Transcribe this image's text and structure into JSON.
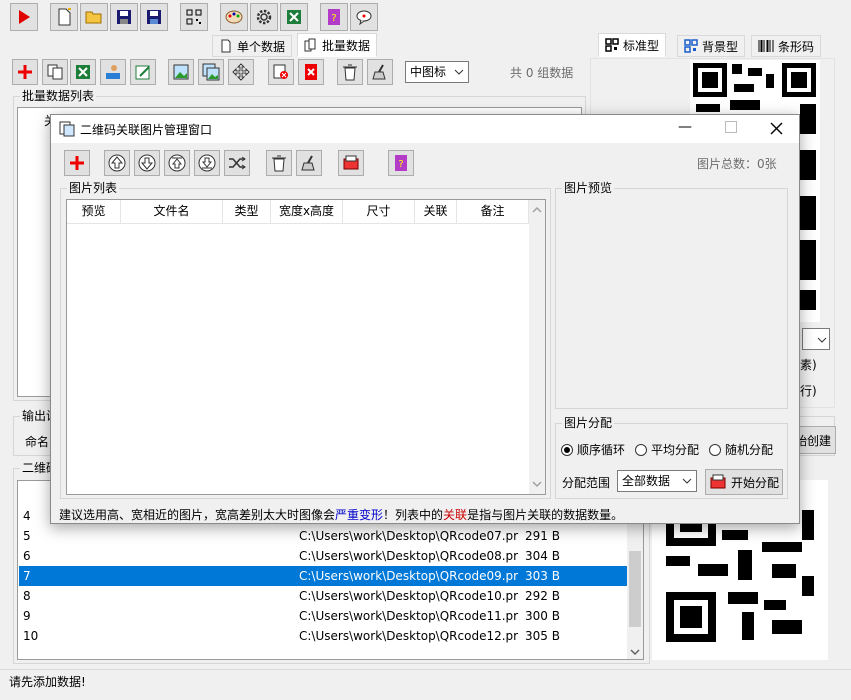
{
  "main_toolbar": {
    "icons": [
      "play-icon",
      "new-file-icon",
      "open-folder-icon",
      "save-icon",
      "save-as-icon",
      "barcode-scan-icon",
      "palette-icon",
      "gear-icon",
      "excel-icon",
      "help-book-icon",
      "chat-icon"
    ]
  },
  "data_tabs": [
    {
      "label": "单个数据",
      "selected": false
    },
    {
      "label": "批量数据",
      "selected": true
    }
  ],
  "preview_tabs": [
    {
      "label": "标准型",
      "selected": true
    },
    {
      "label": "背景型",
      "selected": false
    },
    {
      "label": "条形码",
      "selected": false
    }
  ],
  "batch": {
    "view_mode": "中图标",
    "group_count": "共 0 组数据",
    "list_title": "批量数据列表",
    "partial_col": "关"
  },
  "output": {
    "title_partial": "输出设",
    "name_partial": "命名",
    "create_partial": "始创建"
  },
  "right_partial": {
    "text1": "素)",
    "text2": "行)"
  },
  "qr_list": {
    "title_partial": "二维码",
    "rows": [
      {
        "num": "4",
        "path": "",
        "size": ""
      },
      {
        "num": "5",
        "path": "C:\\Users\\work\\Desktop\\QRcode07.pr",
        "size": "291 B"
      },
      {
        "num": "6",
        "path": "C:\\Users\\work\\Desktop\\QRcode08.pr",
        "size": "304 B"
      },
      {
        "num": "7",
        "path": "C:\\Users\\work\\Desktop\\QRcode09.pr",
        "size": "303 B"
      },
      {
        "num": "8",
        "path": "C:\\Users\\work\\Desktop\\QRcode10.pr",
        "size": "292 B"
      },
      {
        "num": "9",
        "path": "C:\\Users\\work\\Desktop\\QRcode11.pr",
        "size": "300 B"
      },
      {
        "num": "10",
        "path": "C:\\Users\\work\\Desktop\\QRcode12.pr",
        "size": "305 B"
      }
    ],
    "selected_row": "7"
  },
  "status": {
    "text": "请先添加数据!"
  },
  "dialog": {
    "title": "二维码关联图片管理窗口",
    "total": "图片总数：0张",
    "list_title": "图片列表",
    "columns": [
      "预览",
      "文件名",
      "类型",
      "宽度x高度",
      "尺寸",
      "关联",
      "备注"
    ],
    "preview_title": "图片预览",
    "dist": {
      "title": "图片分配",
      "options": [
        {
          "label": "顺序循环",
          "checked": true
        },
        {
          "label": "平均分配",
          "checked": false
        },
        {
          "label": "随机分配",
          "checked": false
        }
      ],
      "range_label": "分配范围",
      "range_value": "全部数据",
      "start_label": "开始分配"
    },
    "note": {
      "part1": "建议选用高、宽相近的图片，宽高差别太大时图像会",
      "part2": "严重变形",
      "part3": "！列表中的",
      "part4": "关联",
      "part5": "是指与图片关联的数据数量。"
    },
    "colors": {
      "blue": "#0000cc",
      "red": "#cc0000"
    }
  }
}
